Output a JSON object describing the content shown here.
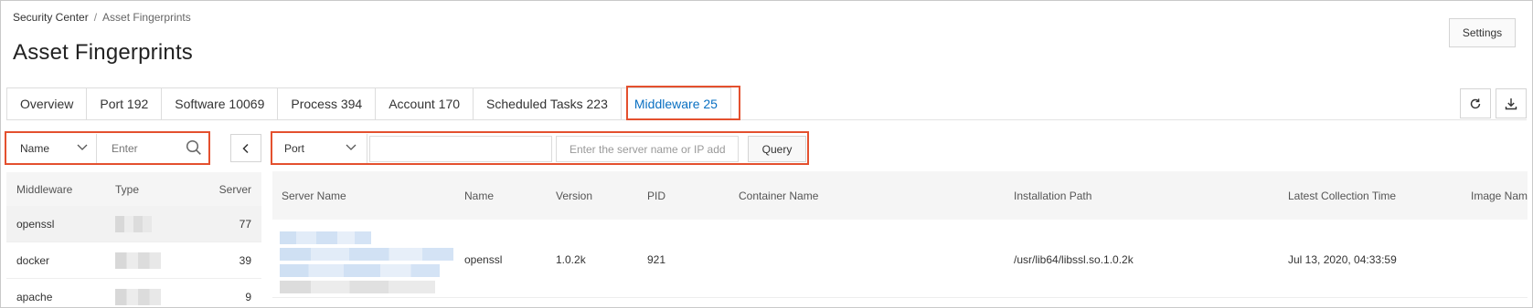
{
  "breadcrumb": {
    "root": "Security Center",
    "separator": "/",
    "current": "Asset Fingerprints"
  },
  "page_title": "Asset Fingerprints",
  "settings_label": "Settings",
  "tabs": [
    {
      "label": "Overview"
    },
    {
      "label": "Port 192"
    },
    {
      "label": "Software 10069"
    },
    {
      "label": "Process 394"
    },
    {
      "label": "Account 170"
    },
    {
      "label": "Scheduled Tasks 223"
    },
    {
      "label": "Middleware 25"
    }
  ],
  "active_tab": "Middleware 25",
  "toolbar_icons": {
    "refresh": "refresh-icon",
    "download": "download-icon"
  },
  "left_panel": {
    "filter_select": "Name",
    "search_placeholder": "Enter",
    "columns": {
      "middleware": "Middleware",
      "type": "Type",
      "server": "Server"
    },
    "rows": [
      {
        "middleware": "openssl",
        "server": "77"
      },
      {
        "middleware": "docker",
        "server": "39"
      },
      {
        "middleware": "apache",
        "server": "9"
      }
    ]
  },
  "query": {
    "field_select": "Port",
    "value": "",
    "server_placeholder": "Enter the server name or IP add",
    "button": "Query"
  },
  "server_table": {
    "columns": {
      "server_name": "Server Name",
      "name": "Name",
      "version": "Version",
      "pid": "PID",
      "container_name": "Container Name",
      "installation_path": "Installation Path",
      "latest_collection_time": "Latest Collection Time",
      "image_name": "Image Nam"
    },
    "rows": [
      {
        "name": "openssl",
        "version": "1.0.2k",
        "pid": "921",
        "container_name": "",
        "installation_path": "/usr/lib64/libssl.so.1.0.2k",
        "latest_collection_time": "Jul 13, 2020, 04:33:59",
        "image_name": ""
      }
    ]
  },
  "colors": {
    "accent": "#0a70c2",
    "highlight": "#e4502e",
    "header_bg": "#f5f5f5",
    "border": "#dddddd"
  }
}
